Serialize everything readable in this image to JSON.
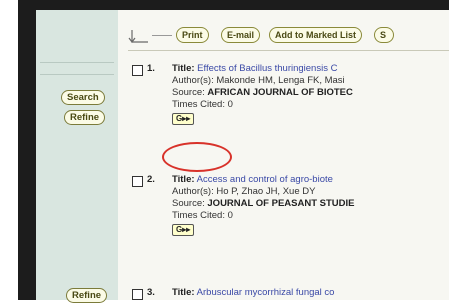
{
  "toolbar": {
    "print_label": "Print",
    "email_label": "E-mail",
    "marked_label": "Add to Marked List",
    "save_label": "S"
  },
  "sidebar": {
    "search_label": "Search",
    "refine_label": "Refine",
    "refine_bottom_label": "Refine"
  },
  "records": [
    {
      "number": "1.",
      "title_label": "Title:",
      "title": "Effects of Bacillus thuringiensis C",
      "authors_label": "Author(s):",
      "authors": "Makonde HM, Lenga FK, Masi",
      "source_label": "Source:",
      "source": "AFRICAN JOURNAL OF BIOTEC",
      "cited_label": "Times Cited:",
      "cited": "0",
      "link_label": "G▸▸"
    },
    {
      "number": "2.",
      "title_label": "Title:",
      "title": "Access and control of agro-biote",
      "authors_label": "Author(s):",
      "authors": "Ho P, Zhao JH, Xue DY",
      "source_label": "Source:",
      "source": "JOURNAL OF PEASANT STUDIE",
      "cited_label": "Times Cited:",
      "cited": "0",
      "link_label": "G▸▸"
    },
    {
      "number": "3.",
      "title_label": "Title:",
      "title": "Arbuscular mycorrhizal fungal co"
    }
  ],
  "colors": {
    "link": "#3a49a6",
    "highlight_circle": "#d8322a",
    "sidebar_bg": "#d9e6e0"
  }
}
